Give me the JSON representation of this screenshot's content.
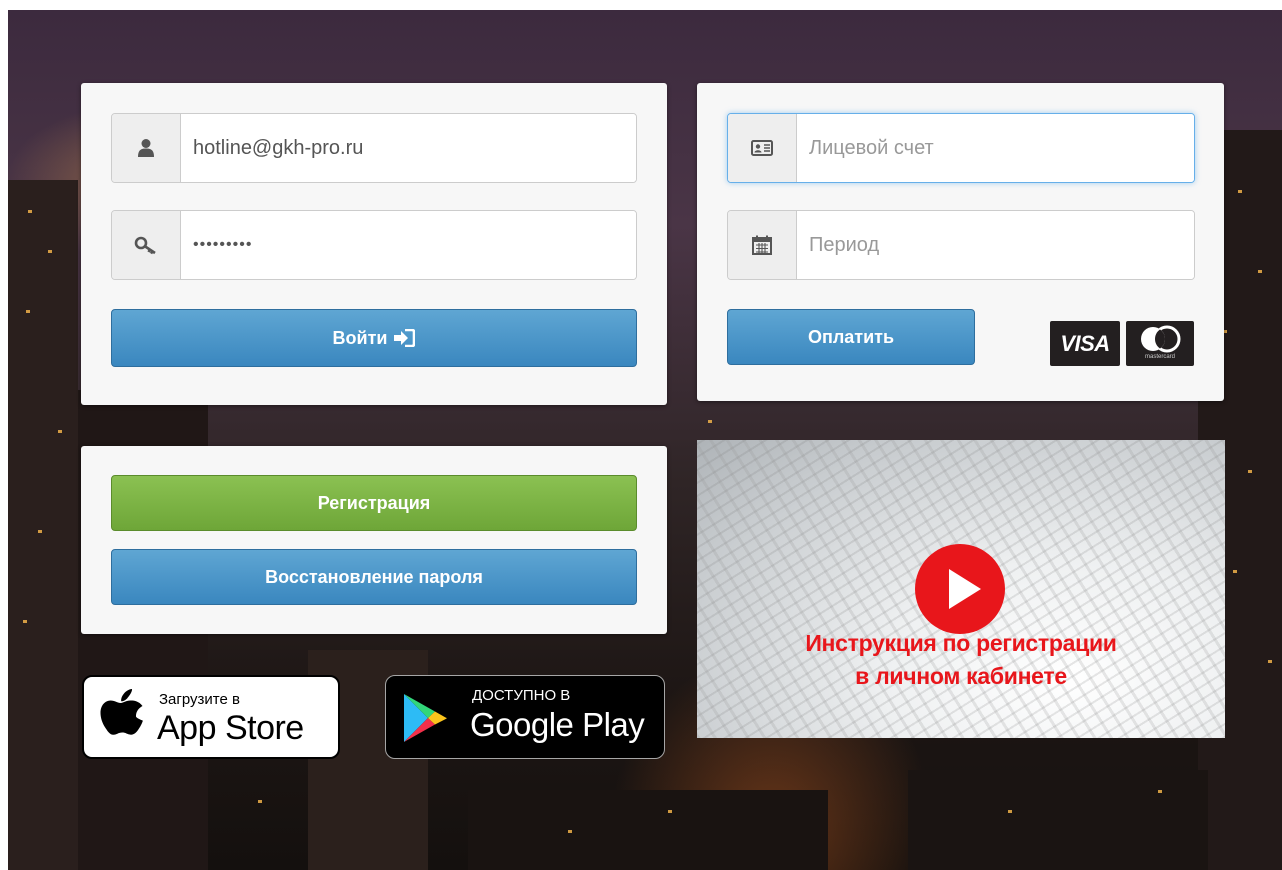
{
  "login": {
    "login_value": "hotline@gkh-pro.ru",
    "password_value": "•••••••••",
    "submit_label": "Войти"
  },
  "payment": {
    "account_placeholder": "Лицевой счет",
    "period_placeholder": "Период",
    "pay_label": "Оплатить",
    "card_brands": [
      "VISA",
      "mastercard"
    ]
  },
  "account_actions": {
    "register_label": "Регистрация",
    "restore_label": "Восстановление пароля"
  },
  "stores": {
    "appstore_small": "Загрузите в",
    "appstore_big": "App Store",
    "googleplay_small": "ДОСТУПНО В",
    "googleplay_big": "Google Play"
  },
  "video": {
    "line1": "Инструкция по регистрации",
    "line2": "в личном кабинете"
  },
  "icons": {
    "login": "user-icon",
    "password": "key-icon",
    "submit": "sign-in-icon",
    "account": "id-card-icon",
    "period": "calendar-icon",
    "play": "play-icon"
  },
  "colors": {
    "primary_button": "#3a87bf",
    "register_button": "#6ea638",
    "play_button": "#e8161b"
  }
}
